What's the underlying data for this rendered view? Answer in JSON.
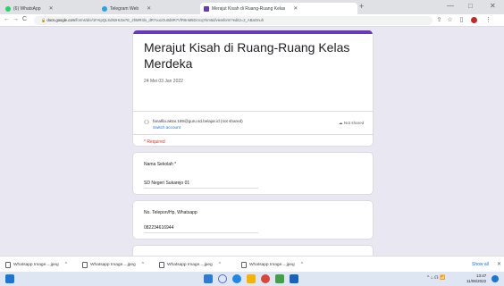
{
  "browser": {
    "tabs": [
      {
        "label": "(6) WhatsApp",
        "favicon_color": "#25d366",
        "active": false
      },
      {
        "label": "Telegram Web",
        "favicon_color": "#2aa3df",
        "active": false
      },
      {
        "label": "Merajut Kisah di Ruang-Ruang Kelas",
        "favicon_color": "#673ab7",
        "active": true
      }
    ],
    "new_tab": "+",
    "window_controls": {
      "minimize": "—",
      "maximize": "□",
      "close": "✕"
    },
    "nav": {
      "back": "←",
      "forward": "→",
      "reload": "C"
    },
    "address": {
      "host": "docs.google.com",
      "path": "/forms/d/e/1FAIpQLSd92HIZw7E_2hMR4lo_dR7ou1Ou0d8R7VfR8nM5DcrcqYkm5d/viewform?edit2=2_ABaOnuh"
    },
    "toolbar_icons": [
      "share-icon",
      "star-icon",
      "extensions-icon",
      "profile-icon",
      "menu-icon"
    ]
  },
  "form": {
    "accent_color": "#673ab7",
    "title": "Merajut Kisah di Ruang-Ruang Kelas Merdeka",
    "date": "24 Mei 03 Jan 2022",
    "account_email": "fanafila.aktar.189@guru.sd.belajar.id (not shared)",
    "switch_account": "Switch account",
    "not_shared": "Not shared",
    "required_note": "* Required",
    "questions": [
      {
        "label": "Nama Sekolah *",
        "answer": "SD Negeri Sukarejo 01"
      },
      {
        "label": "No. Telepon/Hp, Whatsapp",
        "answer": "082234616944"
      }
    ]
  },
  "downloads": {
    "items": [
      "Whatsapp Image....jpeg",
      "Whatsapp Image....jpeg",
      "Whatsapp Image....jpeg",
      "Whatsapp Image....jpeg"
    ],
    "show_all": "Show all",
    "close": "✕"
  },
  "taskbar": {
    "apps": [
      {
        "name": "task-view-app",
        "color": "#2b7cd3"
      },
      {
        "name": "search-app",
        "color": "#4b6fd0"
      },
      {
        "name": "edge-app",
        "color": "#1e88e5"
      },
      {
        "name": "file-explorer-app",
        "color": "#f5b400"
      },
      {
        "name": "chrome-app",
        "color": "#db4437"
      },
      {
        "name": "paint-app",
        "color": "#43a047"
      },
      {
        "name": "photos-app",
        "color": "#1565c0"
      }
    ],
    "tray": "^ ⌂ ☊ 📶",
    "time": "13:47",
    "date": "11/06/2022"
  }
}
